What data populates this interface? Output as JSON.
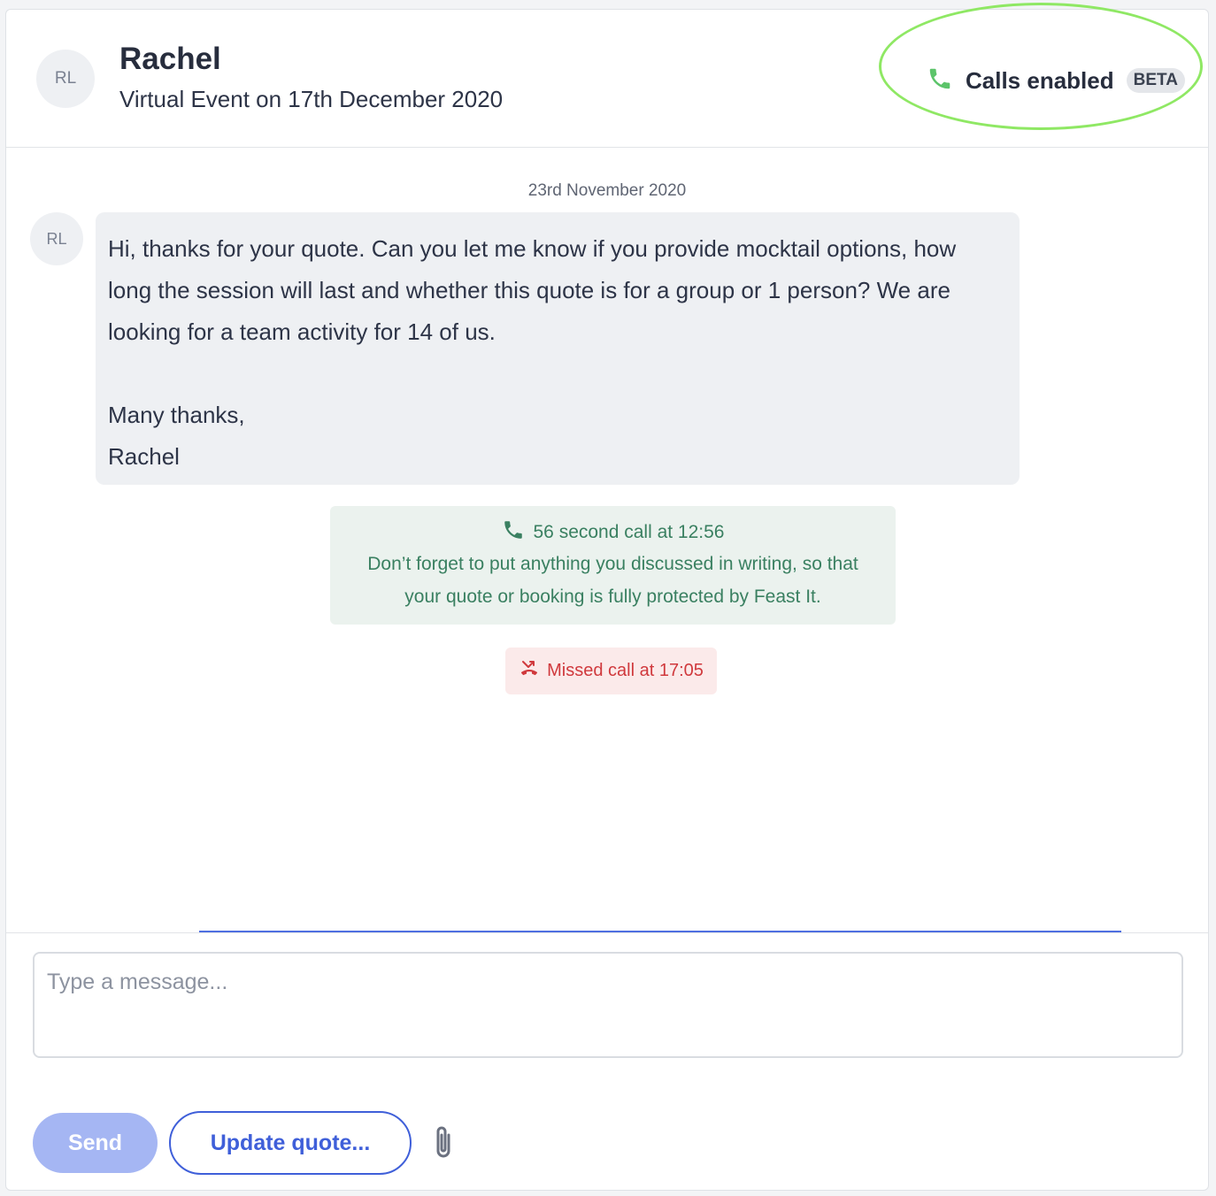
{
  "header": {
    "avatar_initials": "RL",
    "name": "Rachel",
    "subtitle": "Virtual Event on 17th December 2020",
    "calls_label": "Calls enabled",
    "beta_badge": "BETA"
  },
  "conversation": {
    "date_separator": "23rd November 2020",
    "messages": [
      {
        "avatar_initials": "RL",
        "text": "Hi, thanks for your quote. Can you let me know if you provide mocktail options, how\nlong the session will last and whether this quote is for a group or 1 person? We are\nlooking for a team activity for 14 of us.\n\nMany thanks,\nRachel"
      }
    ],
    "call_note": {
      "title": "56 second call at 12:56",
      "text": "Don’t forget to put anything you discussed in writing, so that\nyour quote or booking is fully protected by Feast It."
    },
    "missed_call": "Missed call at 17:05"
  },
  "composer": {
    "placeholder": "Type a message...",
    "value": ""
  },
  "actions": {
    "send_label": "Send",
    "update_quote_label": "Update quote..."
  },
  "icons": {
    "calls": "phone-icon",
    "call_note": "phone-icon",
    "missed": "missed-call-icon",
    "attach": "paperclip-icon"
  },
  "colors": {
    "call_green": "#5cc46a",
    "note_green": "#3a8061",
    "missed_red": "#d0393d",
    "primary_blue": "#3f5fd9",
    "send_disabled": "#a5b6f3",
    "highlight_ring": "#8fe864"
  }
}
